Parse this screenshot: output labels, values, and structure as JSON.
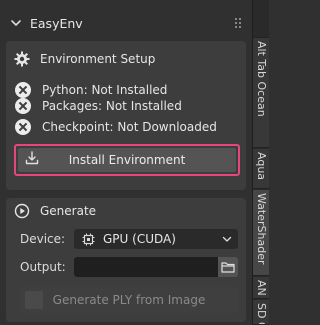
{
  "panel": {
    "title": "EasyEnv",
    "collapse_icon": "chevron-down-icon"
  },
  "environment": {
    "heading": "Environment Setup",
    "heading_icon": "gear-icon",
    "statuses": [
      {
        "label": "Python: Not Installed",
        "icon": "error-circle-icon"
      },
      {
        "label": "Packages: Not Installed",
        "icon": "error-circle-icon"
      },
      {
        "label": "Checkpoint: Not Downloaded",
        "icon": "error-circle-icon"
      }
    ],
    "install_button": "Install Environment",
    "install_icon": "download-icon",
    "highlight_color": "#e8457b"
  },
  "generate": {
    "heading": "Generate",
    "heading_icon": "play-circle-icon",
    "device_label": "Device:",
    "device_value": "GPU (CUDA)",
    "output_label": "Output:",
    "output_value": "",
    "generate_button": "Generate PLY from Image"
  },
  "sidebar_tabs": [
    "Alt Tab Ocean",
    "Aqua",
    "WaterShader",
    "AN",
    "SD G"
  ]
}
